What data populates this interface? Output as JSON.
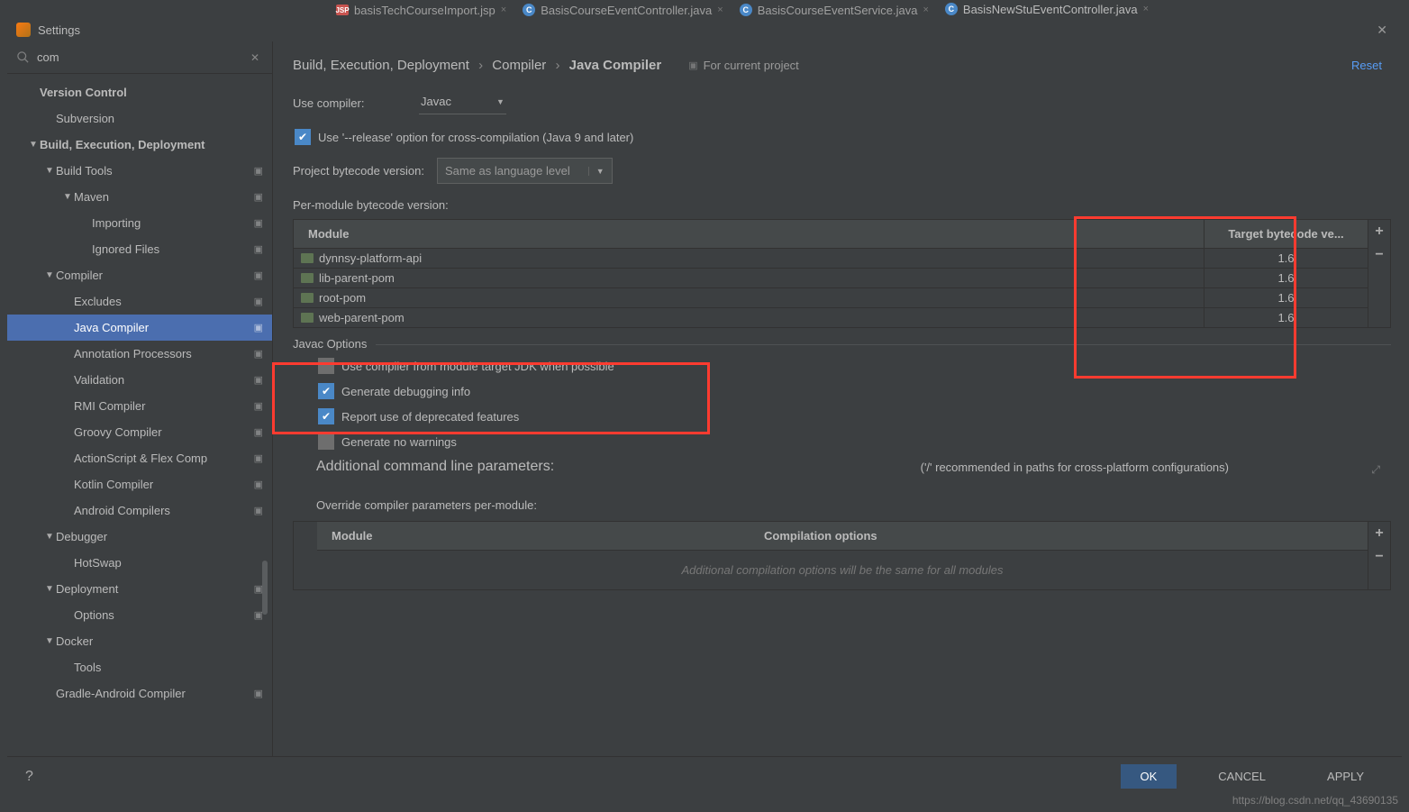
{
  "editor_tabs": [
    {
      "label": "basisTechCourseImport.jsp",
      "type": "jsp",
      "active": false
    },
    {
      "label": "BasisCourseEventController.java",
      "type": "java",
      "active": false
    },
    {
      "label": "BasisCourseEventService.java",
      "type": "java",
      "active": false
    },
    {
      "label": "BasisNewStuEventController.java",
      "type": "java",
      "active": true
    }
  ],
  "dialog": {
    "title": "Settings"
  },
  "search_value": "com",
  "tree": [
    {
      "label": "Version Control",
      "pad": 40,
      "bold": true,
      "arrow": ""
    },
    {
      "label": "Subversion",
      "pad": 58,
      "arrow": ""
    },
    {
      "label": "Build, Execution, Deployment",
      "pad": 40,
      "bold": true,
      "arrow": "▼"
    },
    {
      "label": "Build Tools",
      "pad": 58,
      "arrow": "▼",
      "icon": true
    },
    {
      "label": "Maven",
      "pad": 78,
      "arrow": "▼",
      "icon": true
    },
    {
      "label": "Importing",
      "pad": 98,
      "arrow": "",
      "icon": true
    },
    {
      "label": "Ignored Files",
      "pad": 98,
      "arrow": "",
      "icon": true
    },
    {
      "label": "Compiler",
      "pad": 58,
      "arrow": "▼",
      "icon": true
    },
    {
      "label": "Excludes",
      "pad": 78,
      "arrow": "",
      "icon": true
    },
    {
      "label": "Java Compiler",
      "pad": 78,
      "arrow": "",
      "icon": true,
      "selected": true
    },
    {
      "label": "Annotation Processors",
      "pad": 78,
      "arrow": "",
      "icon": true
    },
    {
      "label": "Validation",
      "pad": 78,
      "arrow": "",
      "icon": true
    },
    {
      "label": "RMI Compiler",
      "pad": 78,
      "arrow": "",
      "icon": true
    },
    {
      "label": "Groovy Compiler",
      "pad": 78,
      "arrow": "",
      "icon": true
    },
    {
      "label": "ActionScript & Flex Comp",
      "pad": 78,
      "arrow": "",
      "icon": true
    },
    {
      "label": "Kotlin Compiler",
      "pad": 78,
      "arrow": "",
      "icon": true
    },
    {
      "label": "Android Compilers",
      "pad": 78,
      "arrow": "",
      "icon": true
    },
    {
      "label": "Debugger",
      "pad": 58,
      "arrow": "▼"
    },
    {
      "label": "HotSwap",
      "pad": 78,
      "arrow": ""
    },
    {
      "label": "Deployment",
      "pad": 58,
      "arrow": "▼",
      "icon": true
    },
    {
      "label": "Options",
      "pad": 78,
      "arrow": "",
      "icon": true
    },
    {
      "label": "Docker",
      "pad": 58,
      "arrow": "▼"
    },
    {
      "label": "Tools",
      "pad": 78,
      "arrow": ""
    },
    {
      "label": "Gradle-Android Compiler",
      "pad": 58,
      "arrow": "",
      "icon": true
    }
  ],
  "breadcrumb": {
    "p1": "Build, Execution, Deployment",
    "p2": "Compiler",
    "p3": "Java Compiler",
    "badge": "For current project",
    "reset": "Reset"
  },
  "form": {
    "use_compiler_label": "Use compiler:",
    "use_compiler_value": "Javac",
    "release_option": "Use '--release' option for cross-compilation (Java 9 and later)",
    "project_bytecode_label": "Project bytecode version:",
    "project_bytecode_value": "Same as language level",
    "per_module_label": "Per-module bytecode version:",
    "module_header_module": "Module",
    "module_header_target": "Target bytecode ve...",
    "modules": [
      {
        "name": "dynnsy-platform-api",
        "target": "1.6"
      },
      {
        "name": "lib-parent-pom",
        "target": "1.6"
      },
      {
        "name": "root-pom",
        "target": "1.6"
      },
      {
        "name": "web-parent-pom",
        "target": "1.6"
      }
    ],
    "javac_legend": "Javac Options",
    "opt_use_module_jdk": "Use compiler from module target JDK when possible",
    "opt_debug": "Generate debugging info",
    "opt_deprecated": "Report use of deprecated features",
    "opt_nowarn": "Generate no warnings",
    "additional_params_label": "Additional command line parameters:",
    "additional_params_note": "('/' recommended in paths for cross-platform configurations)",
    "override_label": "Override compiler parameters per-module:",
    "override_header_module": "Module",
    "override_header_opts": "Compilation options",
    "override_empty": "Additional compilation options will be the same for all modules"
  },
  "footer": {
    "ok": "OK",
    "cancel": "CANCEL",
    "apply": "APPLY"
  },
  "watermark": "https://blog.csdn.net/qq_43690135"
}
